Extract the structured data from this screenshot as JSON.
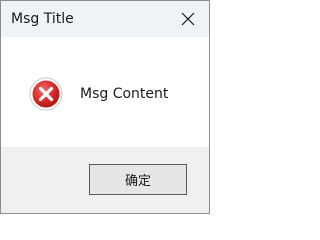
{
  "window": {
    "title": "Msg Title"
  },
  "message": {
    "text": "Msg Content",
    "icon": "error-icon"
  },
  "buttons": {
    "ok_label": "确定"
  },
  "titlebar": {
    "close_icon": "close-icon"
  },
  "colors": {
    "titlebar_bg": "#eef3f7",
    "footer_bg": "#f0f0f0",
    "error_red": "#d62828",
    "button_bg": "#e6e6e6",
    "button_border": "#5a5a5a"
  }
}
